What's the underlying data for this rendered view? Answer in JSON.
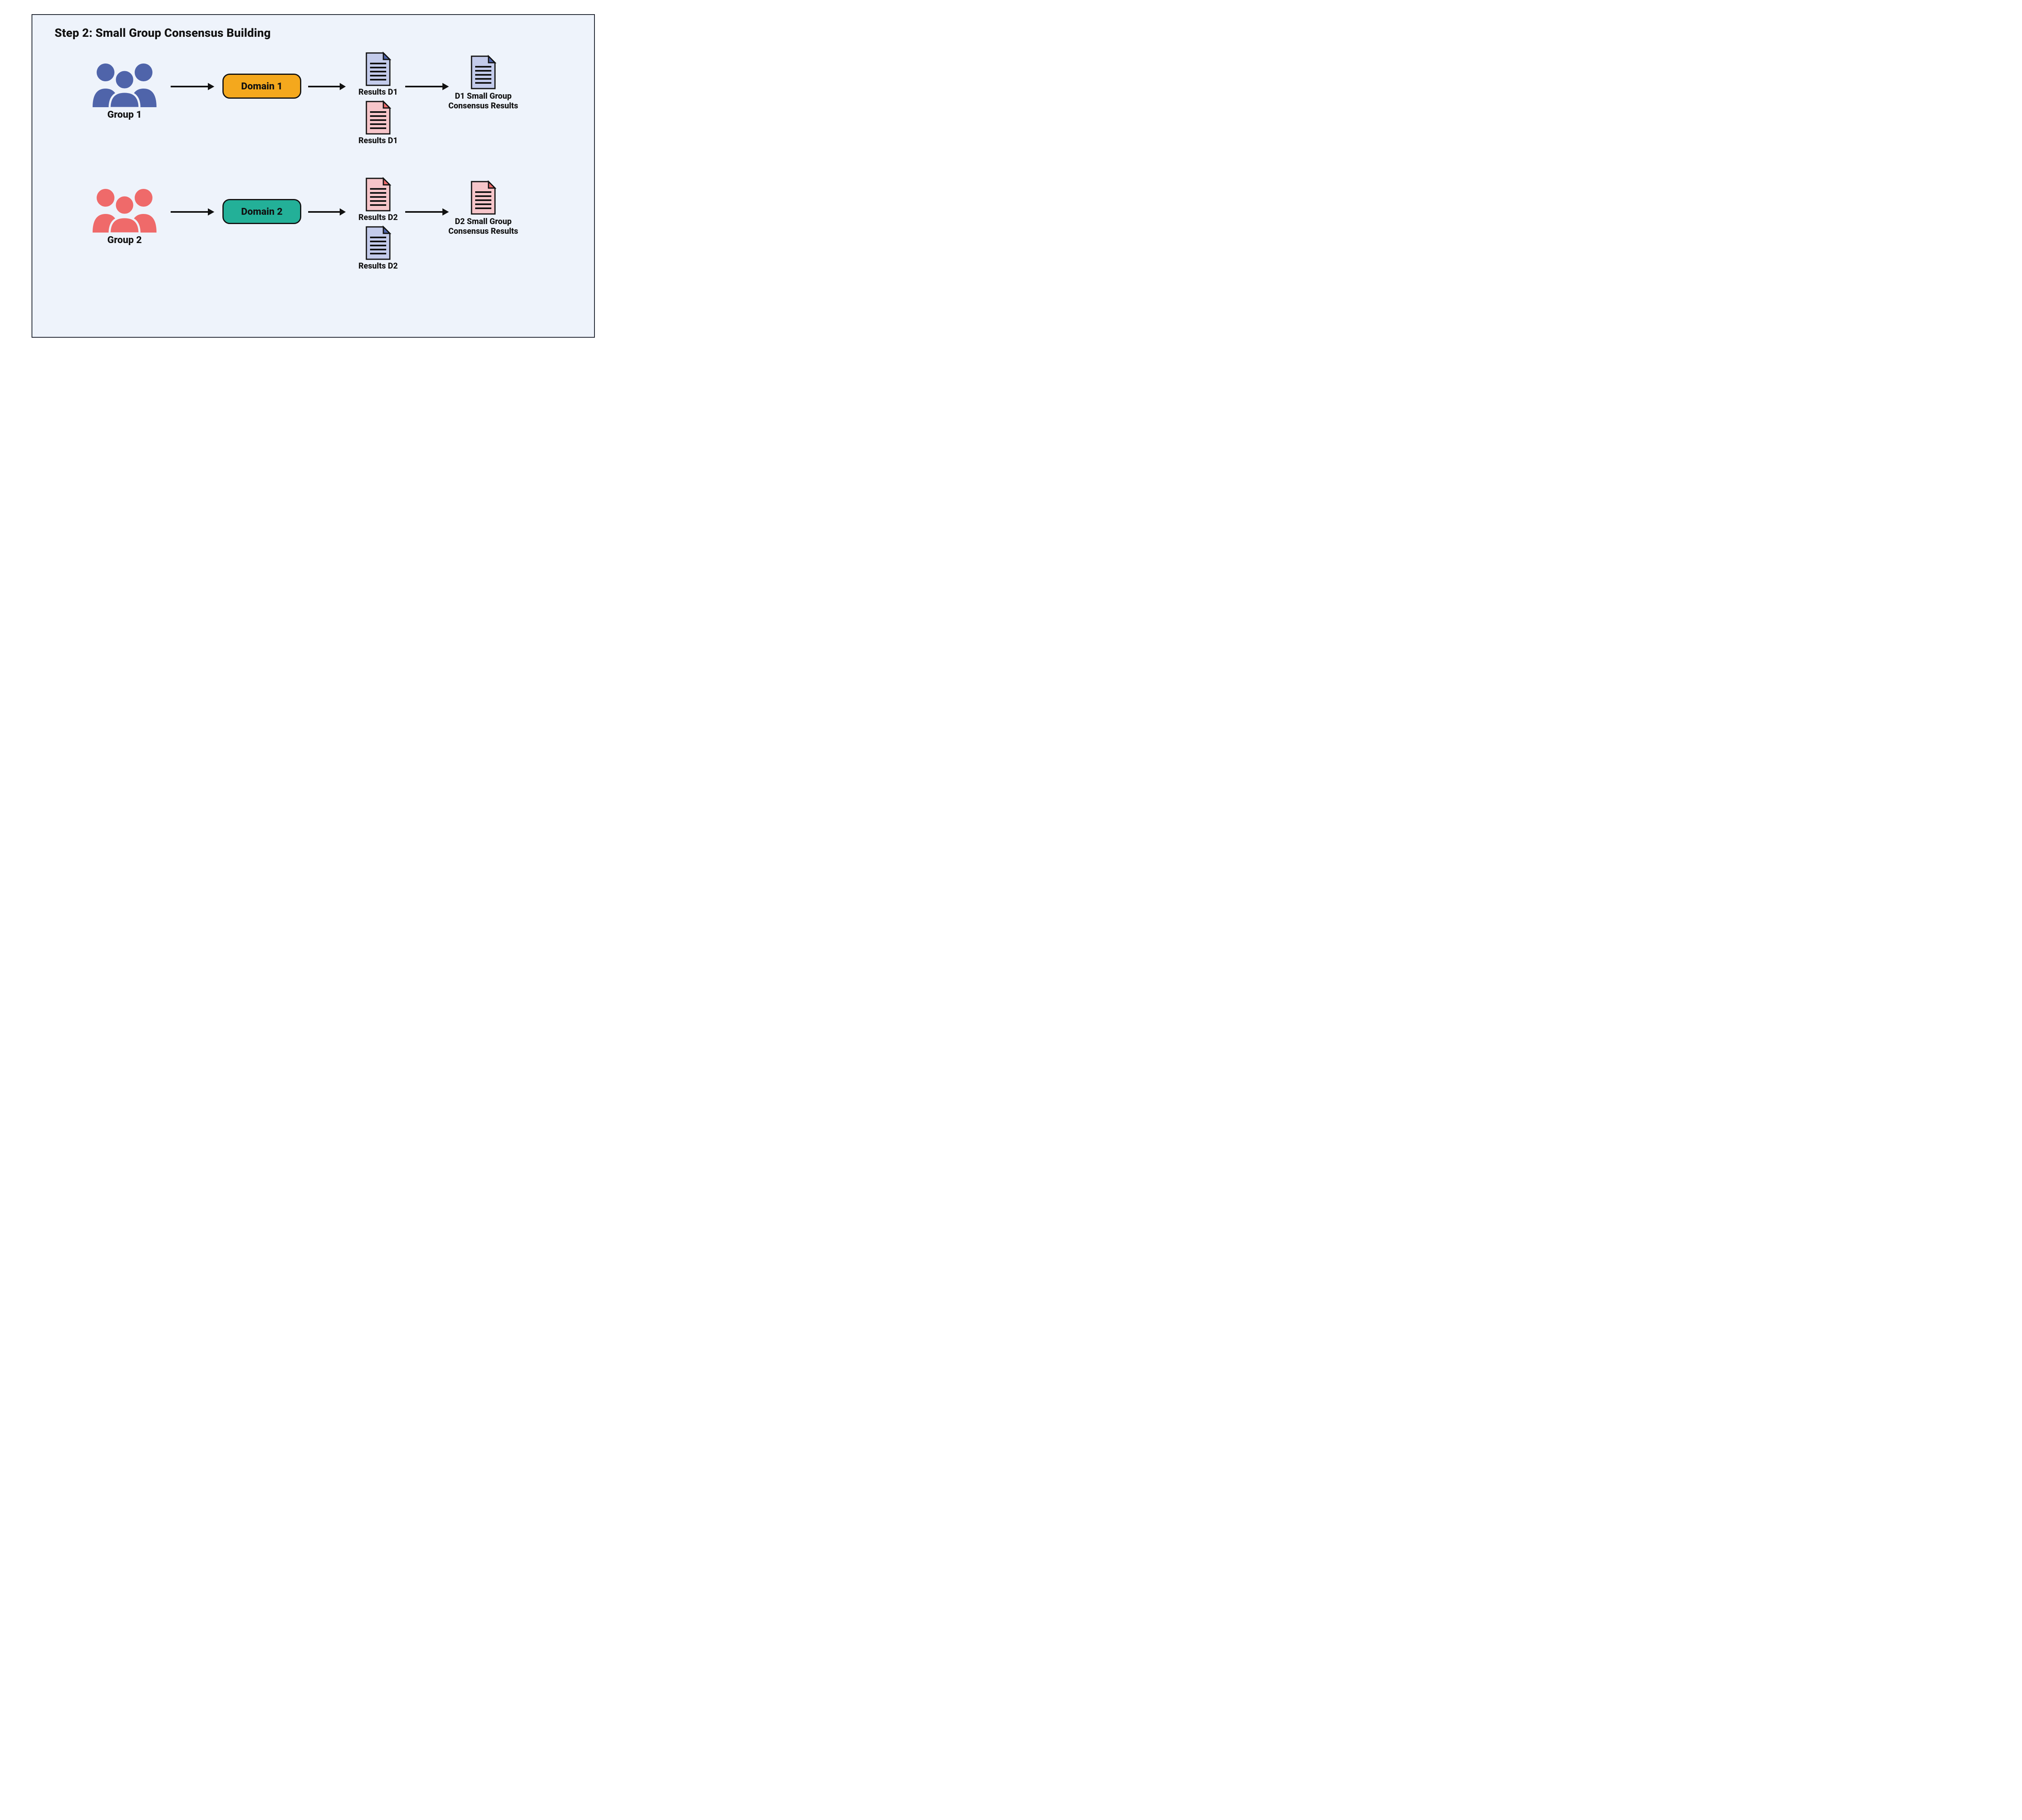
{
  "title": "Step 2: Small Group Consensus Building",
  "colors": {
    "blue": "#4f64aa",
    "coral": "#ef6a6a",
    "orange": "#f4a81d",
    "teal": "#23b098",
    "docBlueFill": "#c3cbeb",
    "docCoralFill": "#f6c5c9",
    "panelBg": "#eef3fb",
    "stroke": "#1f2430"
  },
  "rows": [
    {
      "group_label": "Group 1",
      "group_color": "blue",
      "domain_label": "Domain 1",
      "domain_style": "orange",
      "results": [
        {
          "label": "Results D1",
          "doc_color": "blue"
        },
        {
          "label": "Results D1",
          "doc_color": "coral"
        }
      ],
      "consensus_doc_color": "blue",
      "consensus_label": "D1 Small Group Consensus Results"
    },
    {
      "group_label": "Group 2",
      "group_color": "coral",
      "domain_label": "Domain 2",
      "domain_style": "teal",
      "results": [
        {
          "label": "Results D2",
          "doc_color": "coral"
        },
        {
          "label": "Results D2",
          "doc_color": "blue"
        }
      ],
      "consensus_doc_color": "coral",
      "consensus_label": "D2 Small Group Consensus Results"
    }
  ]
}
